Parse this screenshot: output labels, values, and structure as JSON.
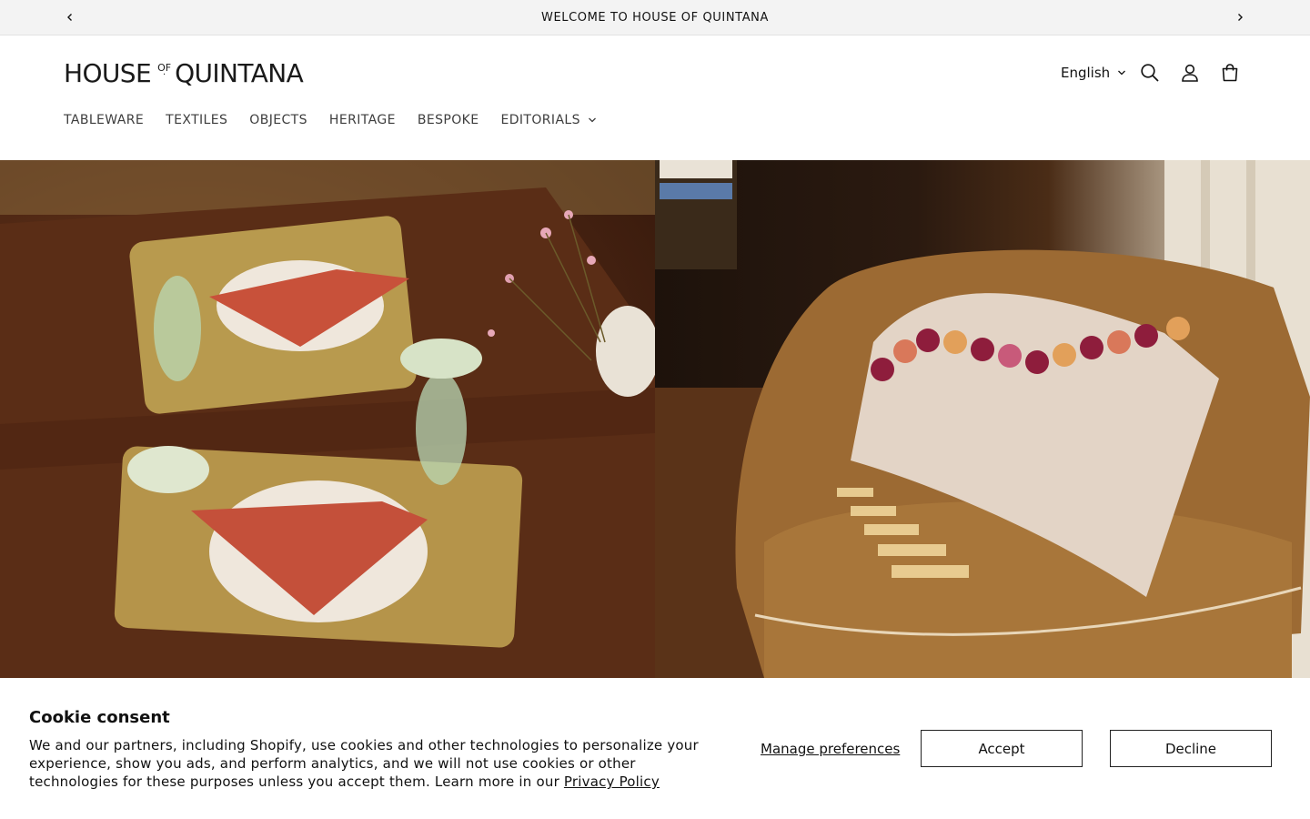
{
  "announcement": {
    "text": "WELCOME TO HOUSE OF QUINTANA",
    "prev_icon": "chevron-left-icon",
    "next_icon": "chevron-right-icon"
  },
  "header": {
    "logo": {
      "part1": "HOUSE",
      "of": "OF",
      "part2": "QUINTANA"
    },
    "language": "English",
    "icons": [
      "search-icon",
      "account-icon",
      "cart-icon"
    ]
  },
  "nav": {
    "items": [
      {
        "label": "TABLEWARE"
      },
      {
        "label": "TEXTILES"
      },
      {
        "label": "OBJECTS"
      },
      {
        "label": "HERITAGE"
      },
      {
        "label": "BESPOKE"
      },
      {
        "label": "EDITORIALS",
        "has_dropdown": true
      }
    ]
  },
  "hero": {
    "colors": {
      "left_base": "#4a2412",
      "right_base": "#8a5a2b",
      "napkin": "#c8513a",
      "placemat": "#b89a4e"
    }
  },
  "cookie": {
    "title": "Cookie consent",
    "body": "We and our partners, including Shopify, use cookies and other technologies to personalize your experience, show you ads, and perform analytics, and we will not use cookies or other technologies for these purposes unless you accept them. Learn more in our ",
    "link": "Privacy Policy",
    "manage": "Manage preferences",
    "accept": "Accept",
    "decline": "Decline"
  }
}
